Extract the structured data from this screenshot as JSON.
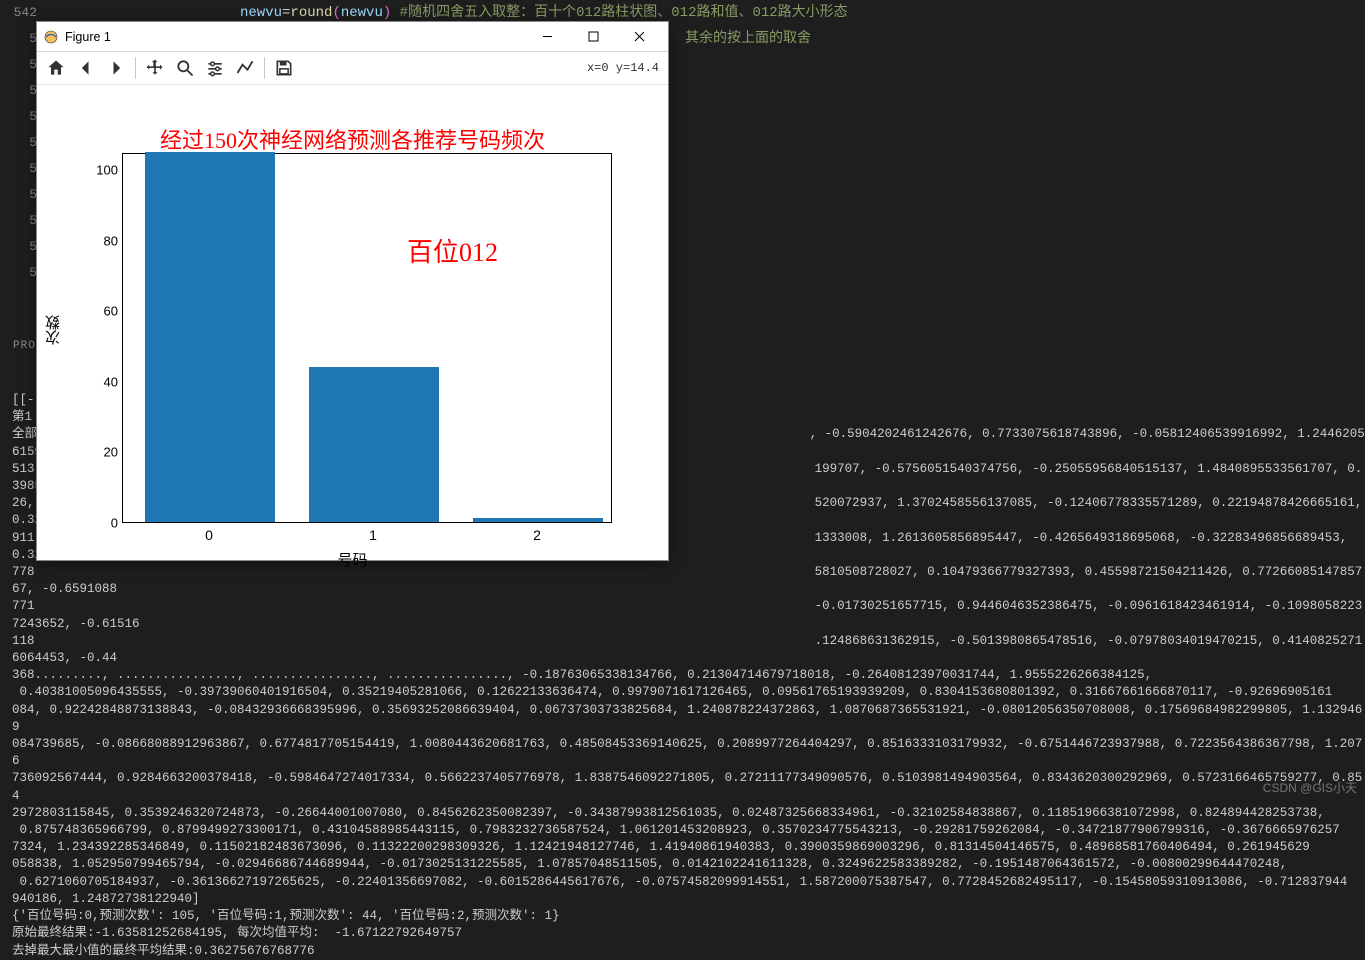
{
  "editor": {
    "line_numbers": [
      "542",
      "5",
      "5",
      "5",
      "5",
      "5",
      "5",
      "5",
      "5",
      "5",
      "5"
    ],
    "line542_var": "newvu",
    "line542_eq": "=",
    "line542_func": "round",
    "line542_paren_open": "(",
    "line542_arg": "newvu",
    "line542_paren_close": ")",
    "line542_comment": " #随机四舍五入取整：百十个012路柱状图、012路和值、012路大小形态",
    "line543_comment": " 其余的按上面的取舍"
  },
  "problems_tab": "PRO",
  "figure": {
    "title": "Figure 1",
    "coord": "x=0 y=14.4",
    "toolbar_icons": [
      "home-icon",
      "back-icon",
      "forward-icon",
      "pan-icon",
      "zoom-icon",
      "configure-icon",
      "line-icon",
      "save-icon"
    ]
  },
  "chart_data": {
    "type": "bar",
    "title": "经过150次神经网络预测各推荐号码频次",
    "annotation": "百位012",
    "xlabel": "号码",
    "ylabel": "次数",
    "ylim": [
      0,
      105
    ],
    "yticks": [
      0,
      20,
      40,
      60,
      80,
      100
    ],
    "categories": [
      "0",
      "1",
      "2"
    ],
    "values": [
      105,
      44,
      1
    ]
  },
  "console_output": "[[-\n第1\n全部                                                                                                       , -0.5904202461242676, 0.7733075618743896, -0.05812406539916992, 1.2446205615997314, 0.\n513                                                                                                        199707, -0.5756051540374756, -0.25055956840515137, 1.4840895533561707, 0.39857745170593\n26,                                                                                                        520072937, 1.3702458556137085, -0.12406778335571289, 0.22194878426665161, 0.32103931903\n911                                                                                                        1333008, 1.2613605856895447, -0.4265649318695068, -0.32283496856689453, 0.322085618972\n778                                                                                                        5810508728027, 0.10479366779327393, 0.45598721504211426, 0.7726608514785767, -0.6591088\n771                                                                                                        -0.01730251657715, 0.9446046352386475, -0.0961618423461914, -0.10980582237243652, -0.61516\n118                                                                                                        .124868631362915, -0.5013980865478516, -0.07978034019470215, 0.41408252716064453, -0.44\n368........., ................, ................, ................, -0.18763065338134766, 0.21304714679718018, -0.26408123970031744, 1.9555226266384125,\n 0.40381005096435555, -0.39739060401916504, 0.35219405281066, 0.12622133636474, 0.9979071617126465, 0.09561765193939209, 0.8304153680801392, 0.31667661666870117, -0.92696905161\n084, 0.92242848873138843, -0.08432936668395996, 0.35693252086639404, 0.06737303733825684, 1.240878224372863, 1.0870687365531921, -0.08012056350708008, 0.17569684982299805, 1.1329469\n084739685, -0.08668088912963867, 0.6774817705154419, 1.0080443620681763, 0.48508453369140625, 0.2089977264404297, 0.8516333103179932, -0.6751446723937988, 0.7223564386367798, 1.2076\n736092567444, 0.9284663200378418, -0.5984647274017334, 0.5662237405776978, 1.8387546092271805, 0.27211177349090576, 0.5103981494903564, 0.8343620300292969, 0.5723166465759277, 0.854\n2972803115845, 0.3539246320724873, -0.26644001007080, 0.8456262350082397, -0.34387993812561035, 0.02487325668334961, -0.32102584838867, 0.11851966381072998, 0.824894428253738,\n 0.875748365966799, 0.8799499273300171, 0.43104588985443115, 0.7983232736587524, 1.061201453208923, 0.3570234775543213, -0.29281759262084, -0.34721877906799316, -0.3676665976257\n7324, 1.234392285346849, 0.11502182483673096, 0.11322200298309326, 1.12421948127746, 1.41940861940383, 0.3900359869003296, 0.81314504146575, 0.48968581760406494, 0.261945629\n058838, 1.052950799465794, -0.02946686744689944, -0.0173025131225585, 1.07857048511505, 0.0142102241611328, 0.3249622583389282, -0.1951487064361572, -0.00800299644470248,\n 0.6271060705184937, -0.36136627197265625, -0.22401356697082, -0.6015286445617676, -0.07574582099914551, 1.587200075387547, 0.7728452682495117, -0.15458059310913086, -0.712837944\n940186, 1.24872738122940]\n{'百位号码:0,预测次数': 105, '百位号码:1,预测次数': 44, '百位号码:2,预测次数': 1}\n原始最终结果:-1.63581252684195, 每次均值平均:  -1.67122792649757\n去掉最大最小值的最终平均结果:0.36275676768776",
  "watermark": "CSDN @GIS小天"
}
